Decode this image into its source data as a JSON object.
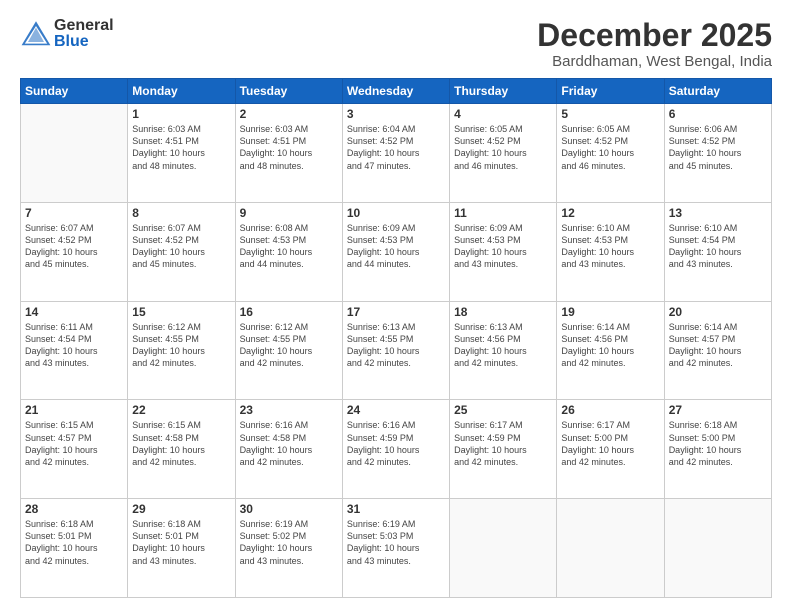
{
  "header": {
    "logo_general": "General",
    "logo_blue": "Blue",
    "title": "December 2025",
    "subtitle": "Barddhaman, West Bengal, India"
  },
  "days_of_week": [
    "Sunday",
    "Monday",
    "Tuesday",
    "Wednesday",
    "Thursday",
    "Friday",
    "Saturday"
  ],
  "weeks": [
    [
      {
        "day": "",
        "info": ""
      },
      {
        "day": "1",
        "info": "Sunrise: 6:03 AM\nSunset: 4:51 PM\nDaylight: 10 hours\nand 48 minutes."
      },
      {
        "day": "2",
        "info": "Sunrise: 6:03 AM\nSunset: 4:51 PM\nDaylight: 10 hours\nand 48 minutes."
      },
      {
        "day": "3",
        "info": "Sunrise: 6:04 AM\nSunset: 4:52 PM\nDaylight: 10 hours\nand 47 minutes."
      },
      {
        "day": "4",
        "info": "Sunrise: 6:05 AM\nSunset: 4:52 PM\nDaylight: 10 hours\nand 46 minutes."
      },
      {
        "day": "5",
        "info": "Sunrise: 6:05 AM\nSunset: 4:52 PM\nDaylight: 10 hours\nand 46 minutes."
      },
      {
        "day": "6",
        "info": "Sunrise: 6:06 AM\nSunset: 4:52 PM\nDaylight: 10 hours\nand 45 minutes."
      }
    ],
    [
      {
        "day": "7",
        "info": "Sunrise: 6:07 AM\nSunset: 4:52 PM\nDaylight: 10 hours\nand 45 minutes."
      },
      {
        "day": "8",
        "info": "Sunrise: 6:07 AM\nSunset: 4:52 PM\nDaylight: 10 hours\nand 45 minutes."
      },
      {
        "day": "9",
        "info": "Sunrise: 6:08 AM\nSunset: 4:53 PM\nDaylight: 10 hours\nand 44 minutes."
      },
      {
        "day": "10",
        "info": "Sunrise: 6:09 AM\nSunset: 4:53 PM\nDaylight: 10 hours\nand 44 minutes."
      },
      {
        "day": "11",
        "info": "Sunrise: 6:09 AM\nSunset: 4:53 PM\nDaylight: 10 hours\nand 43 minutes."
      },
      {
        "day": "12",
        "info": "Sunrise: 6:10 AM\nSunset: 4:53 PM\nDaylight: 10 hours\nand 43 minutes."
      },
      {
        "day": "13",
        "info": "Sunrise: 6:10 AM\nSunset: 4:54 PM\nDaylight: 10 hours\nand 43 minutes."
      }
    ],
    [
      {
        "day": "14",
        "info": "Sunrise: 6:11 AM\nSunset: 4:54 PM\nDaylight: 10 hours\nand 43 minutes."
      },
      {
        "day": "15",
        "info": "Sunrise: 6:12 AM\nSunset: 4:55 PM\nDaylight: 10 hours\nand 42 minutes."
      },
      {
        "day": "16",
        "info": "Sunrise: 6:12 AM\nSunset: 4:55 PM\nDaylight: 10 hours\nand 42 minutes."
      },
      {
        "day": "17",
        "info": "Sunrise: 6:13 AM\nSunset: 4:55 PM\nDaylight: 10 hours\nand 42 minutes."
      },
      {
        "day": "18",
        "info": "Sunrise: 6:13 AM\nSunset: 4:56 PM\nDaylight: 10 hours\nand 42 minutes."
      },
      {
        "day": "19",
        "info": "Sunrise: 6:14 AM\nSunset: 4:56 PM\nDaylight: 10 hours\nand 42 minutes."
      },
      {
        "day": "20",
        "info": "Sunrise: 6:14 AM\nSunset: 4:57 PM\nDaylight: 10 hours\nand 42 minutes."
      }
    ],
    [
      {
        "day": "21",
        "info": "Sunrise: 6:15 AM\nSunset: 4:57 PM\nDaylight: 10 hours\nand 42 minutes."
      },
      {
        "day": "22",
        "info": "Sunrise: 6:15 AM\nSunset: 4:58 PM\nDaylight: 10 hours\nand 42 minutes."
      },
      {
        "day": "23",
        "info": "Sunrise: 6:16 AM\nSunset: 4:58 PM\nDaylight: 10 hours\nand 42 minutes."
      },
      {
        "day": "24",
        "info": "Sunrise: 6:16 AM\nSunset: 4:59 PM\nDaylight: 10 hours\nand 42 minutes."
      },
      {
        "day": "25",
        "info": "Sunrise: 6:17 AM\nSunset: 4:59 PM\nDaylight: 10 hours\nand 42 minutes."
      },
      {
        "day": "26",
        "info": "Sunrise: 6:17 AM\nSunset: 5:00 PM\nDaylight: 10 hours\nand 42 minutes."
      },
      {
        "day": "27",
        "info": "Sunrise: 6:18 AM\nSunset: 5:00 PM\nDaylight: 10 hours\nand 42 minutes."
      }
    ],
    [
      {
        "day": "28",
        "info": "Sunrise: 6:18 AM\nSunset: 5:01 PM\nDaylight: 10 hours\nand 42 minutes."
      },
      {
        "day": "29",
        "info": "Sunrise: 6:18 AM\nSunset: 5:01 PM\nDaylight: 10 hours\nand 43 minutes."
      },
      {
        "day": "30",
        "info": "Sunrise: 6:19 AM\nSunset: 5:02 PM\nDaylight: 10 hours\nand 43 minutes."
      },
      {
        "day": "31",
        "info": "Sunrise: 6:19 AM\nSunset: 5:03 PM\nDaylight: 10 hours\nand 43 minutes."
      },
      {
        "day": "",
        "info": ""
      },
      {
        "day": "",
        "info": ""
      },
      {
        "day": "",
        "info": ""
      }
    ]
  ]
}
